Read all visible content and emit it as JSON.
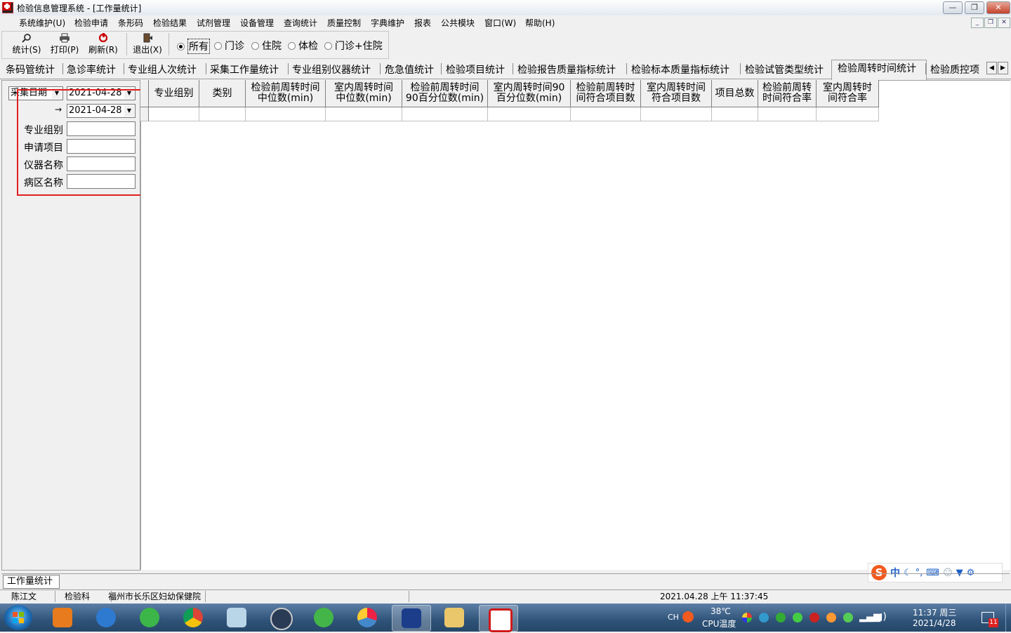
{
  "window": {
    "title": "检验信息管理系统 - [工作量统计]",
    "controls": {
      "minimize": "—",
      "restore": "❐",
      "close": "✕"
    }
  },
  "menubar": {
    "items": [
      "系统维护(U)",
      "检验申请",
      "条形码",
      "检验结果",
      "试剂管理",
      "设备管理",
      "查询统计",
      "质量控制",
      "字典维护",
      "报表",
      "公共模块",
      "窗口(W)",
      "帮助(H)"
    ],
    "mdi_controls": {
      "minimize": "_",
      "restore": "❐",
      "close": "✕"
    }
  },
  "toolbar": {
    "stats_label": "统计(S)",
    "print_label": "打印(P)",
    "refresh_label": "刷新(R)",
    "exit_label": "退出(X)",
    "patient_type_options": [
      "所有",
      "门诊",
      "住院",
      "体检",
      "门诊+住院"
    ],
    "patient_type_selected": "所有"
  },
  "tabs": {
    "items": [
      "条码管统计",
      "急诊率统计",
      "专业组人次统计",
      "采集工作量统计",
      "专业组别仪器统计",
      "危急值统计",
      "检验项目统计",
      "检验报告质量指标统计",
      "检验标本质量指标统计",
      "检验试管类型统计",
      "检验周转时间统计",
      "检验质控项"
    ],
    "active": "检验周转时间统计",
    "scroll_left": "◀",
    "scroll_right": "▶"
  },
  "filters": {
    "date_type": "采集日期",
    "date_from": "2021-04-28",
    "arrow": "→",
    "date_to": "2021-04-28",
    "group_label": "专业组别",
    "item_label": "申请项目",
    "instrument_label": "仪器名称",
    "ward_label": "病区名称",
    "group_value": "",
    "item_value": "",
    "instrument_value": "",
    "ward_value": ""
  },
  "grid": {
    "columns": [
      [
        "专业组别"
      ],
      [
        "类别"
      ],
      [
        "检验前周转时间",
        "中位数(min)"
      ],
      [
        "室内周转时间",
        "中位数(min)"
      ],
      [
        "检验前周转时间",
        "90百分位数(min)"
      ],
      [
        "室内周转时间90",
        "百分位数(min)"
      ],
      [
        "检验前周转时",
        "间符合项目数"
      ],
      [
        "室内周转时间",
        "符合项目数"
      ],
      [
        "项目总数"
      ],
      [
        "检验前周转",
        "时间符合率"
      ],
      [
        "室内周转时",
        "间符合率"
      ]
    ],
    "rows": []
  },
  "bottom_tab": "工作量统计",
  "ime": {
    "logo": "S",
    "mode": "中"
  },
  "status": {
    "user": "陈江文",
    "department": "检验科",
    "hospital": "福州市长乐区妇幼保健院",
    "datetime": "2021.04.28 上午 11:37:45"
  },
  "taskbar": {
    "lang": "CH",
    "temp": "38℃",
    "temp_label": "CPU温度",
    "clock_time": "11:37 周三",
    "clock_date": "2021/4/28",
    "notify_count": "11",
    "colors": {
      "accent": "#2f5379",
      "highlight": "#e02020"
    }
  }
}
